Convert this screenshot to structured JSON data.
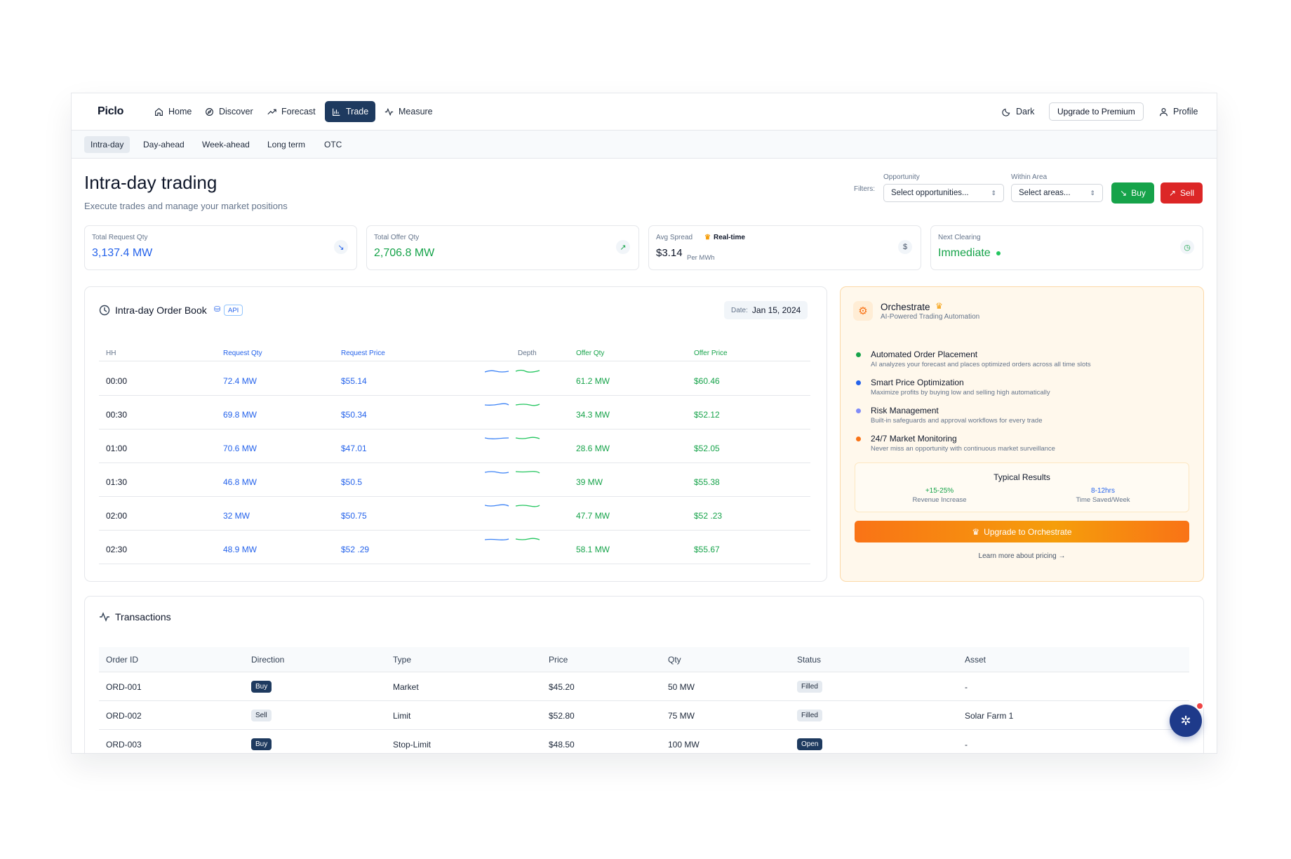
{
  "brand": "Piclo",
  "nav": {
    "items": [
      {
        "label": "Home",
        "icon": "home-icon"
      },
      {
        "label": "Discover",
        "icon": "compass-icon"
      },
      {
        "label": "Forecast",
        "icon": "trend-icon"
      },
      {
        "label": "Trade",
        "icon": "bar-chart-icon",
        "active": true
      },
      {
        "label": "Measure",
        "icon": "pulse-icon"
      }
    ],
    "dark_label": "Dark",
    "upgrade_label": "Upgrade to Premium",
    "profile_label": "Profile"
  },
  "subnav": {
    "tabs": [
      "Intra-day",
      "Day-ahead",
      "Week-ahead",
      "Long term",
      "OTC"
    ],
    "active": "Intra-day"
  },
  "header": {
    "title": "Intra-day trading",
    "subtitle": "Execute trades and manage your market positions"
  },
  "filters": {
    "label": "Filters:",
    "opportunity_label": "Opportunity",
    "opportunity_value": "Select opportunities...",
    "area_label": "Within Area",
    "area_value": "Select areas...",
    "buy_label": "Buy",
    "sell_label": "Sell"
  },
  "stats": {
    "request": {
      "label": "Total Request Qty",
      "value": "3,137.4 MW"
    },
    "offer": {
      "label": "Total Offer Qty",
      "value": "2,706.8 MW"
    },
    "spread": {
      "label": "Avg Spread",
      "badge": "Real-time",
      "value": "$3.14",
      "unit": "Per MWh",
      "icon": "$"
    },
    "clearing": {
      "label": "Next Clearing",
      "value": "Immediate"
    }
  },
  "orderbook": {
    "title": "Intra-day Order Book",
    "api_badge": "API",
    "date_label": "Date:",
    "date_value": "Jan 15, 2024",
    "columns": [
      "HH",
      "Request Qty",
      "Request Price",
      "Depth",
      "Offer Qty",
      "Offer Price"
    ],
    "rows": [
      {
        "hh": "00:00",
        "rq": "72.4 MW",
        "rp": "$55.14",
        "oq": "61.2 MW",
        "op": "$60.46"
      },
      {
        "hh": "00:30",
        "rq": "69.8 MW",
        "rp": "$50.34",
        "oq": "34.3 MW",
        "op": "$52.12"
      },
      {
        "hh": "01:00",
        "rq": "70.6 MW",
        "rp": "$47.01",
        "oq": "28.6 MW",
        "op": "$52.05"
      },
      {
        "hh": "01:30",
        "rq": "46.8 MW",
        "rp": "$50.5",
        "oq": "39 MW",
        "op": "$55.38"
      },
      {
        "hh": "02:00",
        "rq": "32 MW",
        "rp": "$50.75",
        "oq": "47.7 MW",
        "op": "$52 .23"
      },
      {
        "hh": "02:30",
        "rq": "48.9 MW",
        "rp": "$52 .29",
        "oq": "58.1 MW",
        "op": "$55.67"
      }
    ]
  },
  "orchestrate": {
    "title": "Orchestrate",
    "subtitle": "AI-Powered Trading Automation",
    "features": [
      {
        "title": "Automated Order Placement",
        "desc": "AI analyzes your forecast and places optimized orders across all time slots",
        "color": "#16a34a"
      },
      {
        "title": "Smart Price Optimization",
        "desc": "Maximize profits by buying low and selling high automatically",
        "color": "#2563eb"
      },
      {
        "title": "Risk Management",
        "desc": "Built-in safeguards and approval workflows for every trade",
        "color": "#818cf8"
      },
      {
        "title": "24/7 Market Monitoring",
        "desc": "Never miss an opportunity with continuous market surveillance",
        "color": "#f97316"
      }
    ],
    "results_title": "Typical Results",
    "result1_value": "+15-25%",
    "result1_label": "Revenue Increase",
    "result2_value": "8-12hrs",
    "result2_label": "Time Saved/Week",
    "upgrade_label": "Upgrade to Orchestrate",
    "learn_label": "Learn more about pricing →"
  },
  "transactions": {
    "title": "Transactions",
    "columns": [
      "Order ID",
      "Direction",
      "Type",
      "Price",
      "Qty",
      "Status",
      "Asset"
    ],
    "rows": [
      {
        "id": "ORD-001",
        "direction": "Buy",
        "type": "Market",
        "price": "$45.20",
        "qty": "50 MW",
        "status": "Filled",
        "asset": "-"
      },
      {
        "id": "ORD-002",
        "direction": "Sell",
        "type": "Limit",
        "price": "$52.80",
        "qty": "75 MW",
        "status": "Filled",
        "asset": "Solar Farm 1"
      },
      {
        "id": "ORD-003",
        "direction": "Buy",
        "type": "Stop-Limit",
        "price": "$48.50",
        "qty": "100 MW",
        "status": "Open",
        "asset": "-"
      }
    ]
  }
}
